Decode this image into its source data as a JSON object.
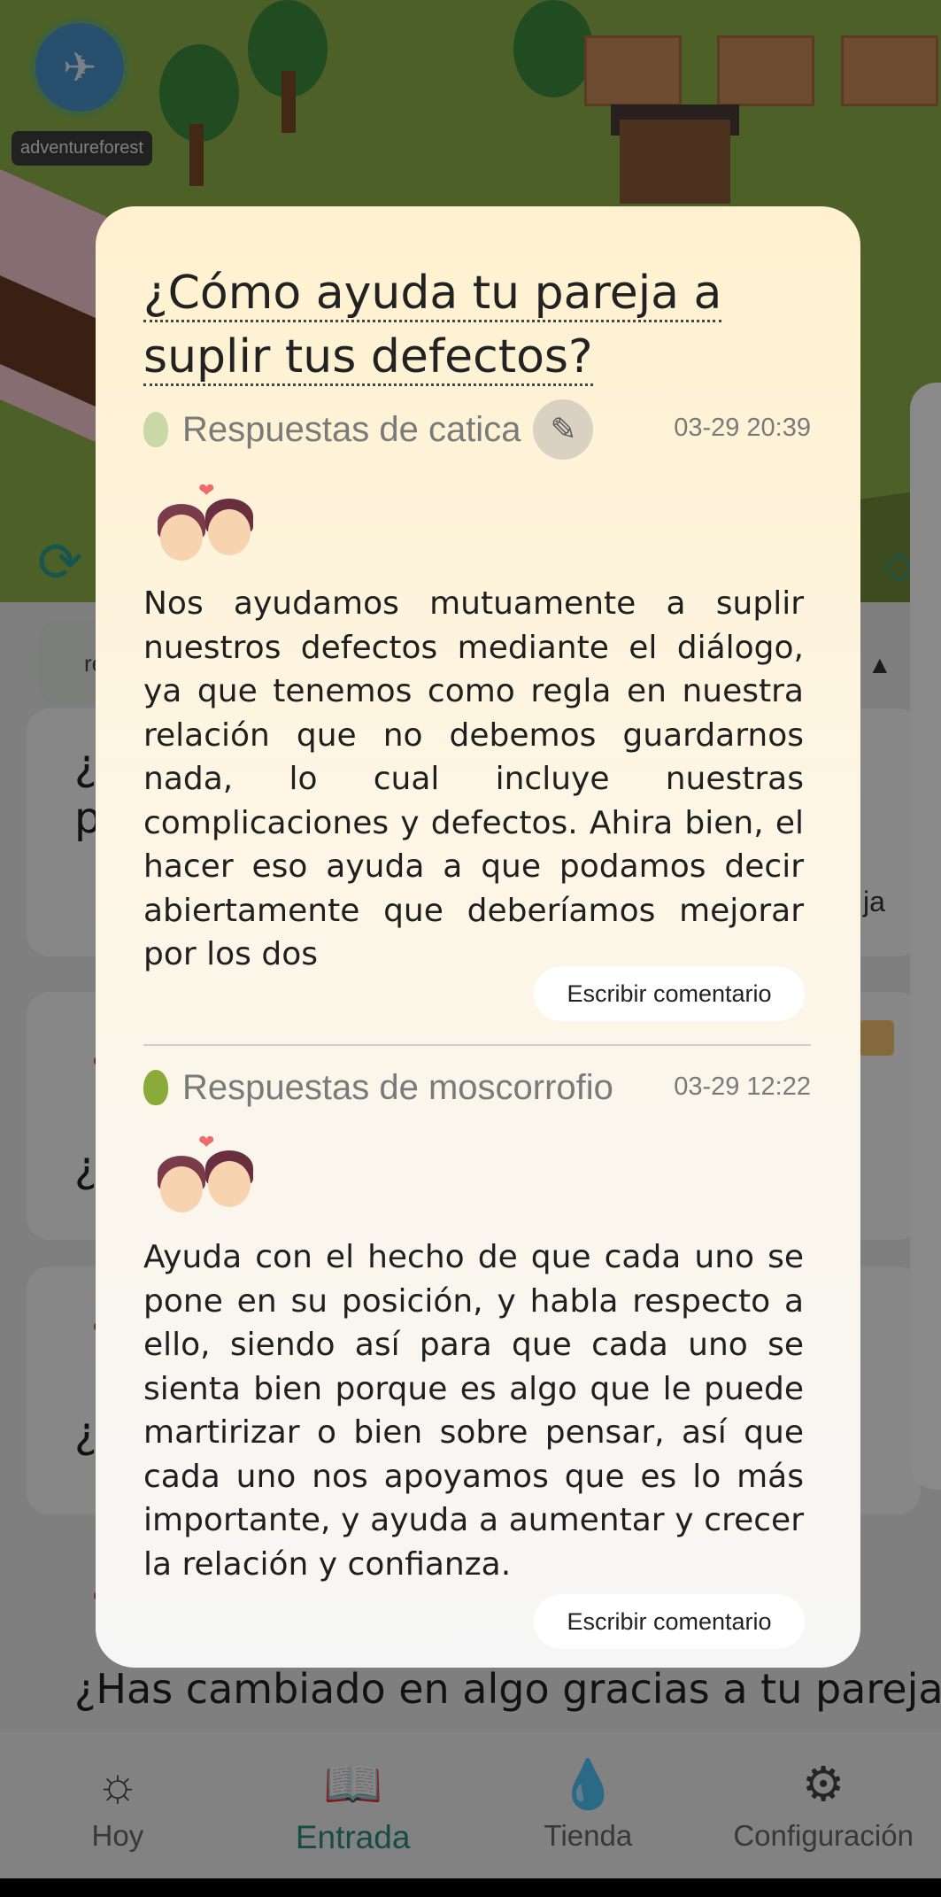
{
  "game": {
    "forest_name": "adventureforest"
  },
  "background": {
    "filter_pill_text": "re",
    "partial_text_ja": "ja",
    "questions": [
      "¿C",
      "p",
      "¿A",
      "¿C"
    ],
    "last_question": "¿Has cambiado en algo gracias a tu pareja?"
  },
  "modal": {
    "question": "¿Cómo ayuda tu pareja a suplir tus defectos?",
    "answers": [
      {
        "label": "Respuestas de catica",
        "time": "03-29 20:39",
        "text": "Nos ayudamos mutuamente a suplir nuestros defectos mediante el diálogo, ya que tenemos como regla en nuestra relación que no debemos guardarnos nada, lo cual incluye nuestras complicaciones y defectos. Ahira bien, el hacer eso ayuda a que podamos decir abiertamente que deberíamos mejorar por los dos",
        "comment_label": "Escribir comentario",
        "icon": "sprout-icon",
        "icon_color": "#c9d9a6"
      },
      {
        "label": "Respuestas de moscorrofio",
        "time": "03-29 12:22",
        "text": "Ayuda con el hecho de que cada uno se pone en su posición, y habla respecto a ello, siendo así para que cada uno se sienta bien porque es algo que le puede martirizar o bien sobre pensar, así que  cada uno nos apoyamos que es lo más importante, y ayuda a aumentar y crecer la relación y confianza.",
        "comment_label": "Escribir comentario",
        "icon": "tree-icon",
        "icon_color": "#8aaa3a"
      }
    ]
  },
  "nav": {
    "items": [
      {
        "label": "Hoy",
        "icon": "sun-icon"
      },
      {
        "label": "Entrada",
        "icon": "book-icon"
      },
      {
        "label": "Tienda",
        "icon": "drop-icon"
      },
      {
        "label": "Configuración",
        "icon": "gear-icon"
      }
    ],
    "active_index": 1,
    "accent_color": "#2a8a7a"
  }
}
